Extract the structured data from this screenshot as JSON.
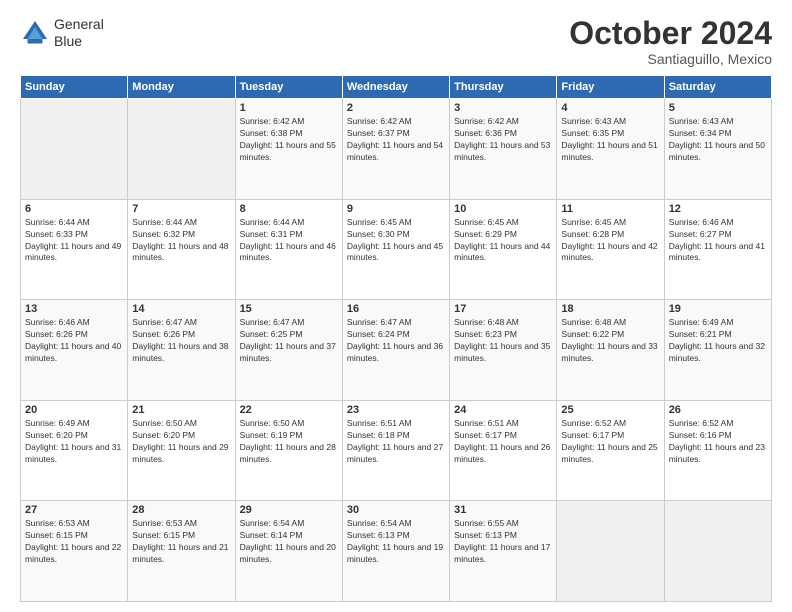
{
  "header": {
    "logo_line1": "General",
    "logo_line2": "Blue",
    "title": "October 2024",
    "subtitle": "Santiaguillo, Mexico"
  },
  "days_of_week": [
    "Sunday",
    "Monday",
    "Tuesday",
    "Wednesday",
    "Thursday",
    "Friday",
    "Saturday"
  ],
  "weeks": [
    [
      {
        "day": "",
        "info": ""
      },
      {
        "day": "",
        "info": ""
      },
      {
        "day": "1",
        "info": "Sunrise: 6:42 AM\nSunset: 6:38 PM\nDaylight: 11 hours and 55 minutes."
      },
      {
        "day": "2",
        "info": "Sunrise: 6:42 AM\nSunset: 6:37 PM\nDaylight: 11 hours and 54 minutes."
      },
      {
        "day": "3",
        "info": "Sunrise: 6:42 AM\nSunset: 6:36 PM\nDaylight: 11 hours and 53 minutes."
      },
      {
        "day": "4",
        "info": "Sunrise: 6:43 AM\nSunset: 6:35 PM\nDaylight: 11 hours and 51 minutes."
      },
      {
        "day": "5",
        "info": "Sunrise: 6:43 AM\nSunset: 6:34 PM\nDaylight: 11 hours and 50 minutes."
      }
    ],
    [
      {
        "day": "6",
        "info": "Sunrise: 6:44 AM\nSunset: 6:33 PM\nDaylight: 11 hours and 49 minutes."
      },
      {
        "day": "7",
        "info": "Sunrise: 6:44 AM\nSunset: 6:32 PM\nDaylight: 11 hours and 48 minutes."
      },
      {
        "day": "8",
        "info": "Sunrise: 6:44 AM\nSunset: 6:31 PM\nDaylight: 11 hours and 46 minutes."
      },
      {
        "day": "9",
        "info": "Sunrise: 6:45 AM\nSunset: 6:30 PM\nDaylight: 11 hours and 45 minutes."
      },
      {
        "day": "10",
        "info": "Sunrise: 6:45 AM\nSunset: 6:29 PM\nDaylight: 11 hours and 44 minutes."
      },
      {
        "day": "11",
        "info": "Sunrise: 6:45 AM\nSunset: 6:28 PM\nDaylight: 11 hours and 42 minutes."
      },
      {
        "day": "12",
        "info": "Sunrise: 6:46 AM\nSunset: 6:27 PM\nDaylight: 11 hours and 41 minutes."
      }
    ],
    [
      {
        "day": "13",
        "info": "Sunrise: 6:46 AM\nSunset: 6:26 PM\nDaylight: 11 hours and 40 minutes."
      },
      {
        "day": "14",
        "info": "Sunrise: 6:47 AM\nSunset: 6:26 PM\nDaylight: 11 hours and 38 minutes."
      },
      {
        "day": "15",
        "info": "Sunrise: 6:47 AM\nSunset: 6:25 PM\nDaylight: 11 hours and 37 minutes."
      },
      {
        "day": "16",
        "info": "Sunrise: 6:47 AM\nSunset: 6:24 PM\nDaylight: 11 hours and 36 minutes."
      },
      {
        "day": "17",
        "info": "Sunrise: 6:48 AM\nSunset: 6:23 PM\nDaylight: 11 hours and 35 minutes."
      },
      {
        "day": "18",
        "info": "Sunrise: 6:48 AM\nSunset: 6:22 PM\nDaylight: 11 hours and 33 minutes."
      },
      {
        "day": "19",
        "info": "Sunrise: 6:49 AM\nSunset: 6:21 PM\nDaylight: 11 hours and 32 minutes."
      }
    ],
    [
      {
        "day": "20",
        "info": "Sunrise: 6:49 AM\nSunset: 6:20 PM\nDaylight: 11 hours and 31 minutes."
      },
      {
        "day": "21",
        "info": "Sunrise: 6:50 AM\nSunset: 6:20 PM\nDaylight: 11 hours and 29 minutes."
      },
      {
        "day": "22",
        "info": "Sunrise: 6:50 AM\nSunset: 6:19 PM\nDaylight: 11 hours and 28 minutes."
      },
      {
        "day": "23",
        "info": "Sunrise: 6:51 AM\nSunset: 6:18 PM\nDaylight: 11 hours and 27 minutes."
      },
      {
        "day": "24",
        "info": "Sunrise: 6:51 AM\nSunset: 6:17 PM\nDaylight: 11 hours and 26 minutes."
      },
      {
        "day": "25",
        "info": "Sunrise: 6:52 AM\nSunset: 6:17 PM\nDaylight: 11 hours and 25 minutes."
      },
      {
        "day": "26",
        "info": "Sunrise: 6:52 AM\nSunset: 6:16 PM\nDaylight: 11 hours and 23 minutes."
      }
    ],
    [
      {
        "day": "27",
        "info": "Sunrise: 6:53 AM\nSunset: 6:15 PM\nDaylight: 11 hours and 22 minutes."
      },
      {
        "day": "28",
        "info": "Sunrise: 6:53 AM\nSunset: 6:15 PM\nDaylight: 11 hours and 21 minutes."
      },
      {
        "day": "29",
        "info": "Sunrise: 6:54 AM\nSunset: 6:14 PM\nDaylight: 11 hours and 20 minutes."
      },
      {
        "day": "30",
        "info": "Sunrise: 6:54 AM\nSunset: 6:13 PM\nDaylight: 11 hours and 19 minutes."
      },
      {
        "day": "31",
        "info": "Sunrise: 6:55 AM\nSunset: 6:13 PM\nDaylight: 11 hours and 17 minutes."
      },
      {
        "day": "",
        "info": ""
      },
      {
        "day": "",
        "info": ""
      }
    ]
  ]
}
